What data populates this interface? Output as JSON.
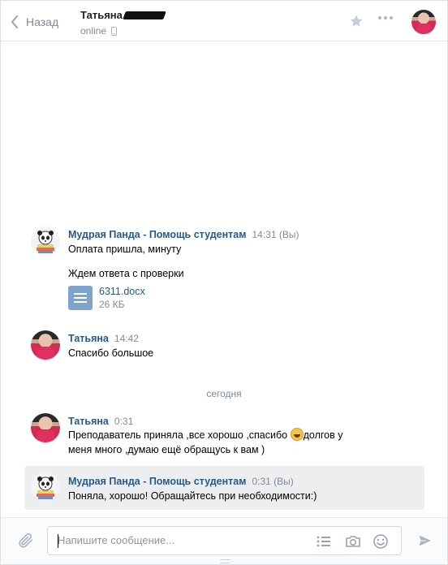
{
  "header": {
    "back_label": "Назад",
    "peer_name": "Татьяна",
    "peer_status": "online"
  },
  "messages": [
    {
      "author": "Мудрая Панда - Помощь студентам",
      "time": "14:31 (Вы)",
      "lines": [
        "Оплата пришла, минуту",
        "Ждем ответа с проверки"
      ],
      "attachment": {
        "name": "6311.docx",
        "size": "26 КБ"
      }
    },
    {
      "author": "Татьяна",
      "time": "14:42",
      "lines": [
        "Спасибо большое"
      ]
    },
    {
      "author": "Татьяна",
      "time": "0:31",
      "line1_before_emoji": "Преподаватель приняла ,все хорошо ,спасибо",
      "line1_after_emoji": "долгов у",
      "line2": "меня много ,думаю ещё обращусь к вам )",
      "emoji": "grinning-face"
    },
    {
      "author": "Мудрая Панда - Помощь студентам",
      "time": "0:31 (Вы)",
      "lines": [
        "Поняла, хорошо! Обращайтесь при необходимости:)"
      ]
    }
  ],
  "divider_label": "сегодня",
  "composer": {
    "placeholder": "Напишите сообщение..."
  },
  "colors": {
    "link": "#2a5885",
    "muted": "#828a99",
    "selected_bg": "#edeef0",
    "doc_icon": "#7fa4cc"
  },
  "icons": [
    "chevron-left-icon",
    "phone-icon",
    "star-icon",
    "more-icon",
    "paperclip-icon",
    "list-icon",
    "camera-icon",
    "smile-icon",
    "send-icon",
    "doc-icon",
    "panda-icon"
  ]
}
